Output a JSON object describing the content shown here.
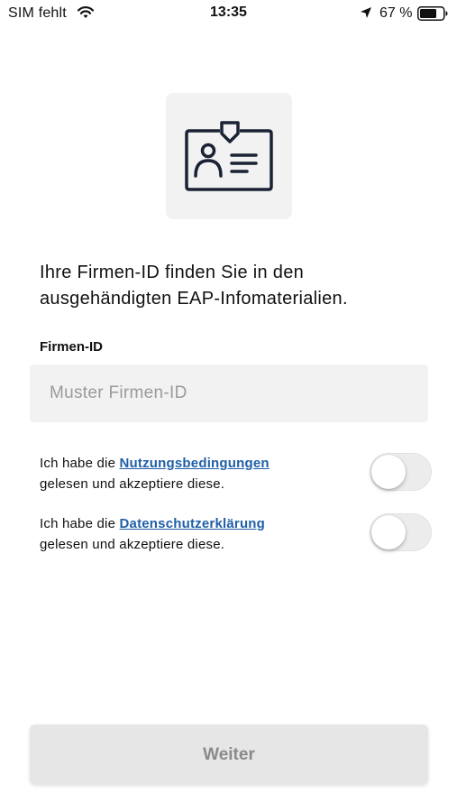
{
  "status_bar": {
    "carrier": "SIM fehlt",
    "time": "13:35",
    "battery_percent": "67 %",
    "icons": [
      "wifi-icon",
      "location-arrow-icon",
      "battery-icon"
    ]
  },
  "hero": {
    "icon": "id-card-icon"
  },
  "intro": {
    "text": "Ihre Firmen-ID finden Sie in den ausgehändigten EAP-Infomaterialien."
  },
  "company_id_field": {
    "label": "Firmen-ID",
    "value": "",
    "placeholder": "Muster Firmen-ID"
  },
  "consents": [
    {
      "prefix": "Ich habe die ",
      "link_text": "Nutzungsbedingungen",
      "suffix": "gelesen und akzeptiere diese.",
      "checked": false
    },
    {
      "prefix": "Ich habe die ",
      "link_text": "Datenschutzerklärung",
      "suffix": "gelesen und akzeptiere diese.",
      "checked": false
    }
  ],
  "continue_button": {
    "label": "Weiter",
    "enabled": false
  },
  "colors": {
    "link": "#1f5fa8",
    "tile_background": "#f2f2f2",
    "button_disabled_bg": "#e6e6e6",
    "button_disabled_text": "#8a8a8a",
    "icon_stroke": "#1a2233"
  }
}
